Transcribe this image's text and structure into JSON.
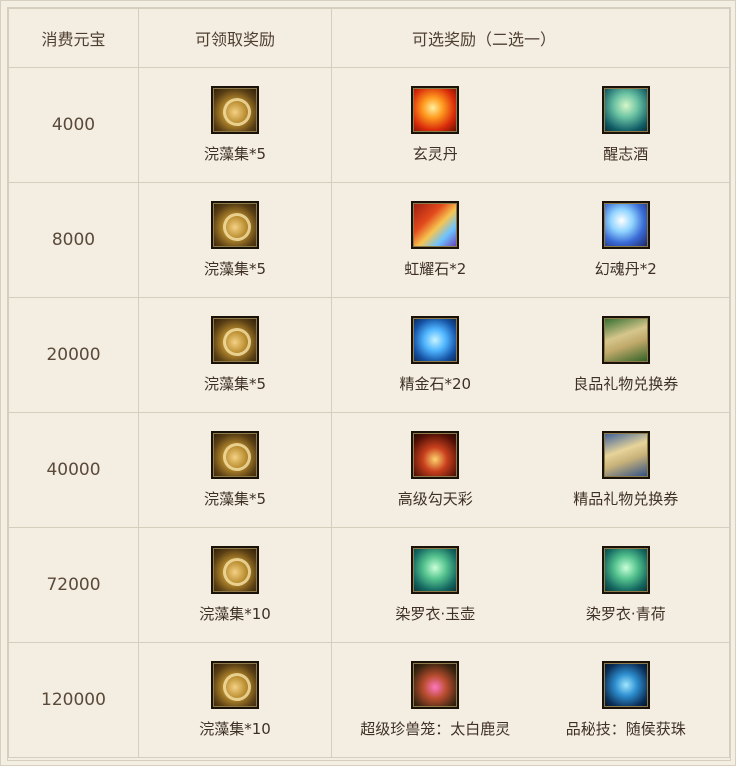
{
  "header": {
    "col1": "消费元宝",
    "col2": "可领取奖励",
    "col3": "可选奖励（二选一）"
  },
  "rows": [
    {
      "amount": "4000",
      "reward": {
        "icon": "gold-feather-bundle-icon",
        "label": "浣藻集*5"
      },
      "choices": [
        {
          "icon": "red-swirl-pill-icon",
          "label": "玄灵丹"
        },
        {
          "icon": "green-cup-icon",
          "label": "醒志酒"
        }
      ]
    },
    {
      "amount": "8000",
      "reward": {
        "icon": "gold-feather-bundle-icon",
        "label": "浣藻集*5"
      },
      "choices": [
        {
          "icon": "rainbow-stone-icon",
          "label": "虹耀石*2"
        },
        {
          "icon": "blue-orb-pill-icon",
          "label": "幻魂丹*2"
        }
      ]
    },
    {
      "amount": "20000",
      "reward": {
        "icon": "gold-feather-bundle-icon",
        "label": "浣藻集*5"
      },
      "choices": [
        {
          "icon": "blue-crystal-icon",
          "label": "精金石*20"
        },
        {
          "icon": "green-gift-ticket-icon",
          "label": "良品礼物兑换券"
        }
      ]
    },
    {
      "amount": "40000",
      "reward": {
        "icon": "gold-feather-bundle-icon",
        "label": "浣藻集*5"
      },
      "choices": [
        {
          "icon": "curved-blade-icon",
          "label": "高级勾天彩"
        },
        {
          "icon": "blue-gift-ticket-icon",
          "label": "精品礼物兑换券"
        }
      ]
    },
    {
      "amount": "72000",
      "reward": {
        "icon": "gold-feather-bundle-icon",
        "label": "浣藻集*10"
      },
      "choices": [
        {
          "icon": "green-jade-ring-icon",
          "label": "染罗衣·玉壶"
        },
        {
          "icon": "green-jade-ring-icon",
          "label": "染罗衣·青荷"
        }
      ]
    },
    {
      "amount": "120000",
      "reward": {
        "icon": "gold-feather-bundle-icon",
        "label": "浣藻集*10"
      },
      "choices": [
        {
          "icon": "beast-cage-icon",
          "label": "超级珍兽笼：太白鹿灵"
        },
        {
          "icon": "skill-silhouette-icon",
          "label": "品秘技：随侯获珠"
        }
      ]
    }
  ]
}
